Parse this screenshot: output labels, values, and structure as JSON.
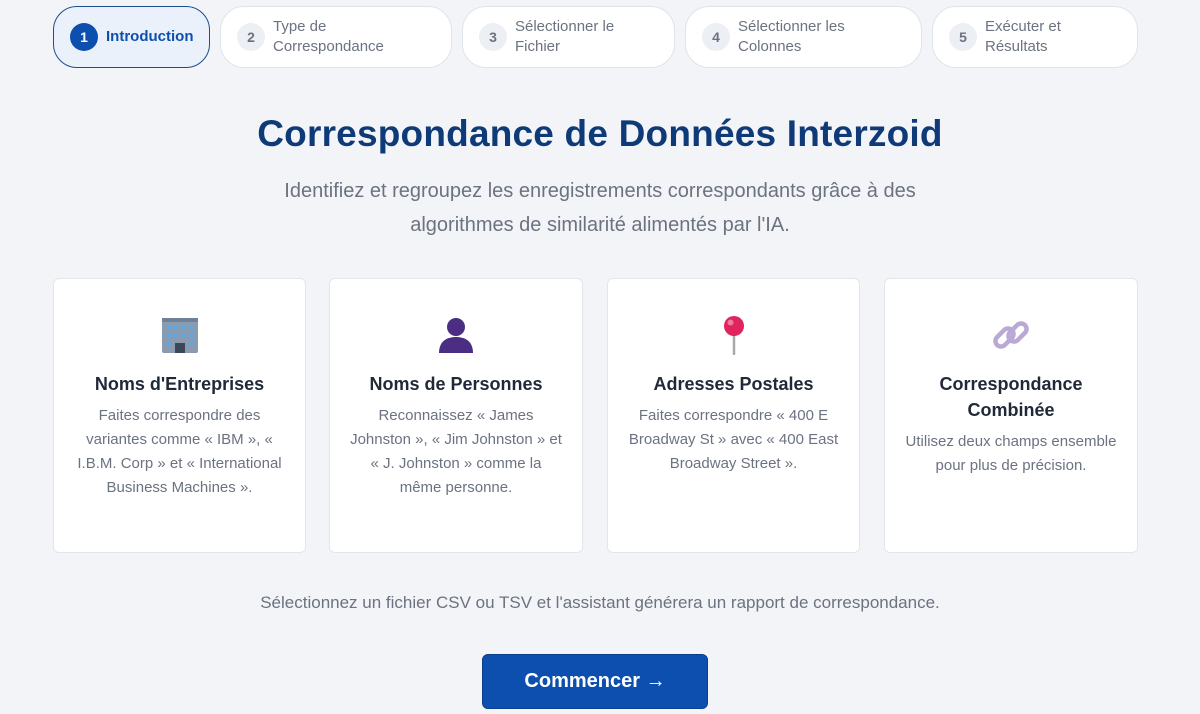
{
  "stepper": {
    "steps": [
      {
        "number": "1",
        "label": "Introduction"
      },
      {
        "number": "2",
        "label": "Type de Correspondance"
      },
      {
        "number": "3",
        "label": "Sélectionner le Fichier"
      },
      {
        "number": "4",
        "label": "Sélectionner les Colonnes"
      },
      {
        "number": "5",
        "label": "Exécuter et Résultats"
      }
    ],
    "active_step": 1
  },
  "hero": {
    "title": "Correspondance de Données Interzoid",
    "subtitle": "Identifiez et regroupez les enregistrements correspondants grâce à des algorithmes de similarité alimentés par l'IA."
  },
  "cards": [
    {
      "icon": "office-building-icon",
      "title": "Noms d'Entreprises",
      "text": "Faites correspondre des variantes comme « IBM », « I.B.M. Corp » et « International Business Machines »."
    },
    {
      "icon": "person-silhouette-icon",
      "title": "Noms de Personnes",
      "text": "Reconnaissez « James Johnston », « Jim Johnston » et « J. Johnston » comme la même personne."
    },
    {
      "icon": "pushpin-icon",
      "title": "Adresses Postales",
      "text": "Faites correspondre « 400 E Broadway St » avec « 400 East Broadway Street »."
    },
    {
      "icon": "chain-link-icon",
      "title": "Correspondance Combinée",
      "text": "Utilisez deux champs ensemble pour plus de précision."
    }
  ],
  "footer": {
    "text": "Sélectionnez un fichier CSV ou TSV et l'assistant générera un rapport de correspondance.",
    "button_label": "Commencer →"
  },
  "colors": {
    "accent": "#0d4fae",
    "title": "#0f3a78",
    "background": "#f3f4f7"
  }
}
